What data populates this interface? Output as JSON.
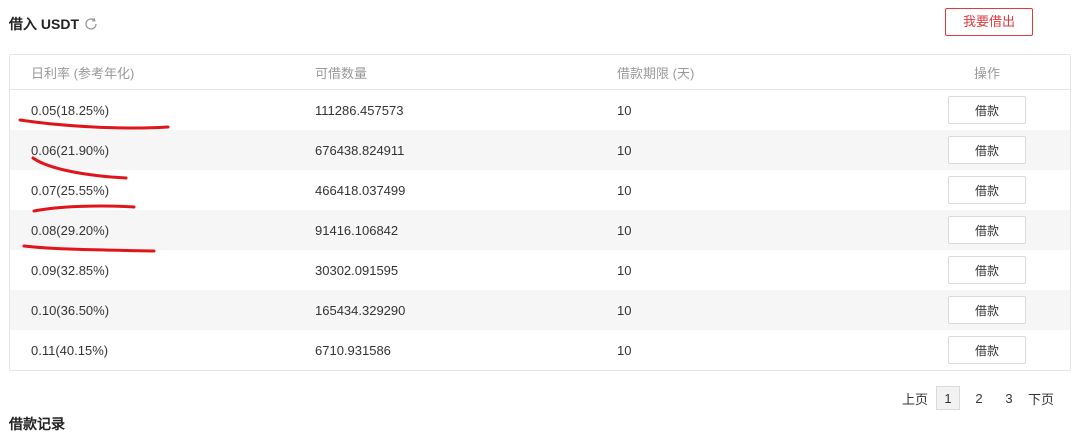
{
  "header": {
    "title": "借入 USDT",
    "refresh_icon": "refresh-icon",
    "lend_button": "我要借出"
  },
  "table": {
    "columns": [
      "日利率 (参考年化)",
      "可借数量",
      "借款期限 (天)",
      "操作"
    ],
    "rows": [
      {
        "rate": "0.05(18.25%)",
        "amount": "111286.457573",
        "term": "10",
        "action": "借款"
      },
      {
        "rate": "0.06(21.90%)",
        "amount": "676438.824911",
        "term": "10",
        "action": "借款"
      },
      {
        "rate": "0.07(25.55%)",
        "amount": "466418.037499",
        "term": "10",
        "action": "借款"
      },
      {
        "rate": "0.08(29.20%)",
        "amount": "91416.106842",
        "term": "10",
        "action": "借款"
      },
      {
        "rate": "0.09(32.85%)",
        "amount": "30302.091595",
        "term": "10",
        "action": "借款"
      },
      {
        "rate": "0.10(36.50%)",
        "amount": "165434.329290",
        "term": "10",
        "action": "借款"
      },
      {
        "rate": "0.11(40.15%)",
        "amount": "6710.931586",
        "term": "10",
        "action": "借款"
      }
    ]
  },
  "pagination": {
    "prev": "上页",
    "pages": [
      "1",
      "2",
      "3"
    ],
    "current": "1",
    "next": "下页"
  },
  "records_title": "借款记录",
  "colors": {
    "accent": "#e0393e",
    "annotation": "#e0141b"
  }
}
